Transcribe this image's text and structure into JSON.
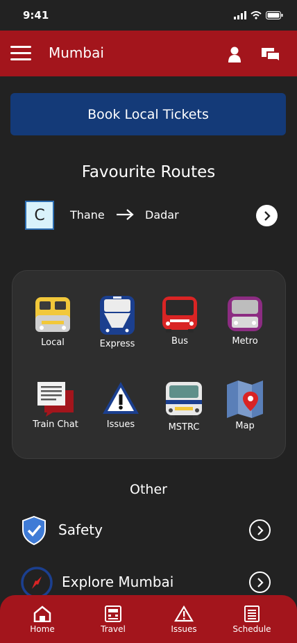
{
  "status_bar": {
    "time": "9:41"
  },
  "header": {
    "city": "Mumbai",
    "menu_icon": "hamburger-icon",
    "profile_icon": "user-icon",
    "chat_icon": "chat-icon"
  },
  "book_button": {
    "label": "Book Local Tickets",
    "color": "#143a78"
  },
  "favourites": {
    "title": "Favourite Routes",
    "routes": [
      {
        "badge": "C",
        "from": "Thane",
        "to": "Dadar"
      }
    ]
  },
  "services": [
    {
      "label": "Local",
      "icon": "local-train-icon"
    },
    {
      "label": "Express",
      "icon": "express-train-icon"
    },
    {
      "label": "Bus",
      "icon": "bus-icon"
    },
    {
      "label": "Metro",
      "icon": "metro-icon"
    },
    {
      "label": "Train Chat",
      "icon": "train-chat-icon"
    },
    {
      "label": "Issues",
      "icon": "warning-icon"
    },
    {
      "label": "MSTRC",
      "icon": "mstrc-bus-icon"
    },
    {
      "label": "Map",
      "icon": "map-icon"
    }
  ],
  "other": {
    "title": "Other",
    "items": [
      {
        "label": "Safety",
        "icon": "shield-check-icon"
      },
      {
        "label": "Explore Mumbai",
        "icon": "compass-icon"
      }
    ]
  },
  "bottom_nav": [
    {
      "label": "Home",
      "icon": "home-icon"
    },
    {
      "label": "Travel",
      "icon": "travel-icon"
    },
    {
      "label": "Issues",
      "icon": "warning-icon"
    },
    {
      "label": "Schedule",
      "icon": "schedule-icon"
    }
  ],
  "colors": {
    "brand_red": "#a3151c",
    "background": "#222222"
  }
}
